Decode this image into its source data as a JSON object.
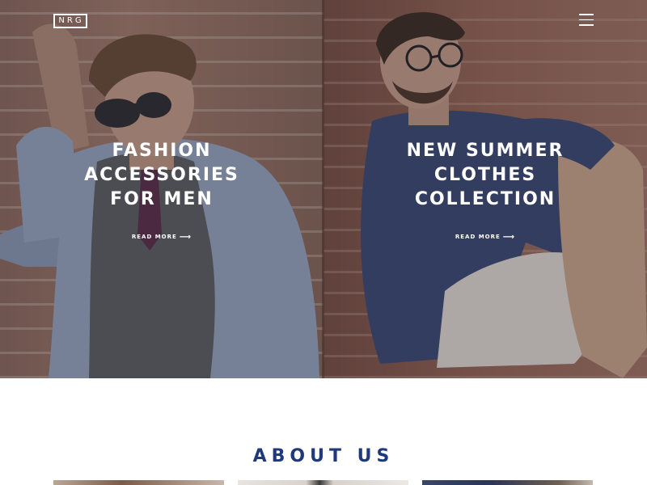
{
  "header": {
    "logo_text": "NRG",
    "menu_icon": "hamburger-menu-icon"
  },
  "hero": {
    "panels": [
      {
        "title_lines": [
          "FASHION",
          "ACCESSORIES",
          "FOR MEN"
        ],
        "cta_label": "READ MORE",
        "cta_icon": "arrow-right-icon"
      },
      {
        "title_lines": [
          "NEW SUMMER",
          "CLOTHES",
          "COLLECTION"
        ],
        "cta_label": "READ MORE",
        "cta_icon": "arrow-right-icon"
      }
    ]
  },
  "about": {
    "title": "ABOUT US"
  },
  "colors": {
    "accent": "#1f3a7a",
    "overlay_text": "#ffffff",
    "page_bg": "#ffffff"
  }
}
